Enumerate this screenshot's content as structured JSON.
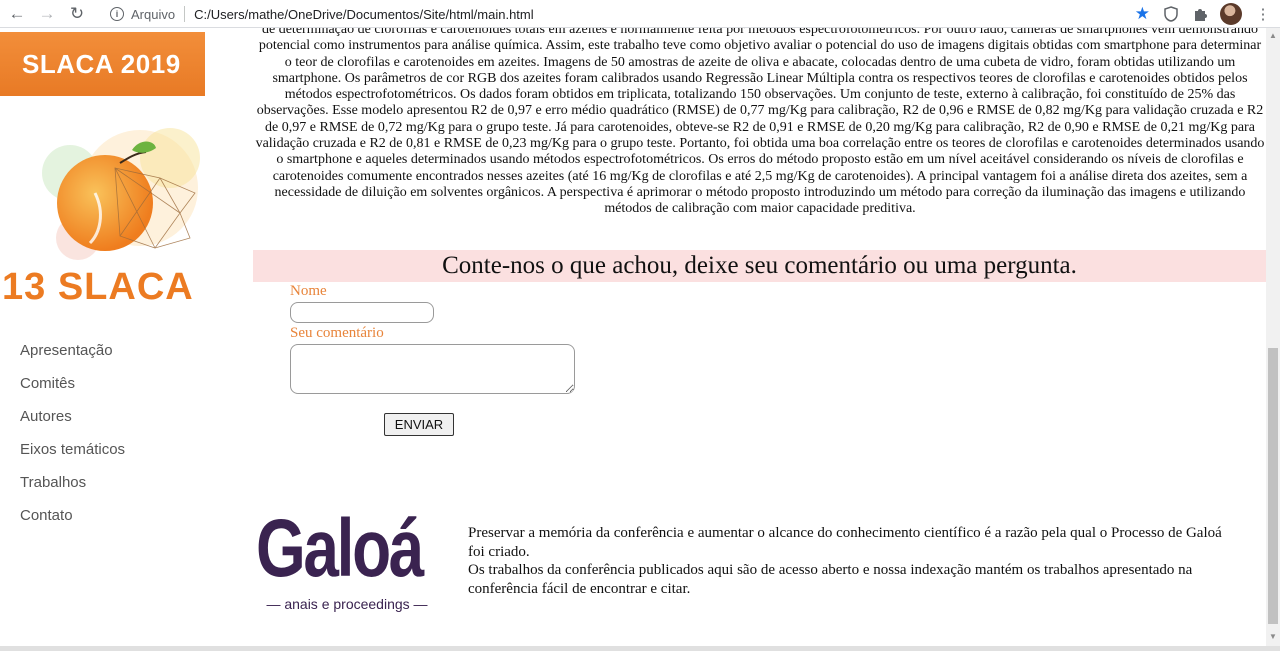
{
  "browser": {
    "back": "←",
    "forward": "→",
    "reload": "↻",
    "protocol_label": "Arquivo",
    "url": "C:/Users/mathe/OneDrive/Documentos/Site/html/main.html",
    "bookmark_icon": "star-icon",
    "extension_icons": [
      "shield-icon",
      "puzzle-icon"
    ],
    "menu": "⋮"
  },
  "sidebar": {
    "banner_title": "SLACA 2019",
    "logo_title": "13 SLACA",
    "menu_items": [
      "Apresentação",
      "Comitês",
      "Autores",
      "Eixos temáticos",
      "Trabalhos",
      "Contato"
    ]
  },
  "abstract": {
    "text": "de determinação de clorofilas e carotenoides totais em azeites é normalmente feita por métodos espectrofotométricos. Por outro lado, câmeras de smartphones vêm demonstrando potencial como instrumentos para análise química. Assim, este trabalho teve como objetivo avaliar o potencial do uso de imagens digitais obtidas com smartphone para determinar o teor de clorofilas e carotenoides em azeites. Imagens de 50 amostras de azeite de oliva e abacate, colocadas dentro de uma cubeta de vidro, foram obtidas utilizando um smartphone. Os parâmetros de cor RGB dos azeites foram calibrados usando Regressão Linear Múltipla contra os respectivos teores de clorofilas e carotenoides obtidos pelos métodos espectrofotométricos. Os dados foram obtidos em triplicata, totalizando 150 observações. Um conjunto de teste, externo à calibração, foi constituído de 25% das observações. Esse modelo apresentou R2 de 0,97 e erro médio quadrático (RMSE) de 0,77 mg/Kg para calibração, R2 de 0,96 e RMSE de 0,82 mg/Kg para validação cruzada e R2 de 0,97 e RMSE de 0,72 mg/Kg para o grupo teste. Já para carotenoides, obteve-se R2 de 0,91 e RMSE de 0,20 mg/Kg para calibração, R2 de 0,90 e RMSE de 0,21 mg/Kg para validação cruzada e R2 de 0,81 e RMSE de 0,23 mg/Kg para o grupo teste. Portanto, foi obtida uma boa correlação entre os teores de clorofilas e carotenoides determinados usando o smartphone e aqueles determinados usando métodos espectrofotométricos. Os erros do método proposto estão em um nível aceitável considerando os níveis de clorofilas e carotenoides comumente encontrados nesses azeites (até 16 mg/Kg de clorofilas e até 2,5 mg/Kg de carotenoides). A principal vantagem foi a análise direta dos azeites, sem a necessidade de diluição em solventes orgânicos. A perspectiva é aprimorar o método proposto introduzindo um método para correção da iluminação das imagens e utilizando métodos de calibração com maior capacidade preditiva."
  },
  "comment_form": {
    "title": "Conte-nos o que achou, deixe seu comentário ou uma pergunta.",
    "name_label": "Nome",
    "name_value": "",
    "comment_label": "Seu comentário",
    "comment_value": "",
    "submit_label": "ENVIAR"
  },
  "footer": {
    "logo_word": "Galoá",
    "logo_sub": "— anais e proceedings —",
    "paragraph_1": "Preservar a memória da conferência e aumentar o alcance do conhecimento científico é a razão pela qual o Processo de Galoá foi criado.",
    "paragraph_2": "Os trabalhos da conferência publicados aqui são de acesso aberto e nossa indexação mantém os trabalhos apresentado na conferência fácil de encontrar e citar."
  },
  "colors": {
    "accent_orange": "#e8843a",
    "banner_orange": "#f28e3a",
    "comment_band": "#fbe0e0",
    "galoa_purple": "#3a2350"
  }
}
